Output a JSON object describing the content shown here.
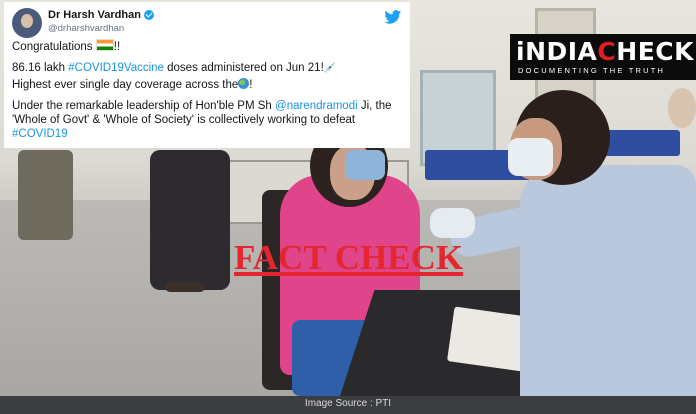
{
  "tweet": {
    "author_name": "Dr Harsh Vardhan",
    "author_handle": "@drharshvardhan",
    "line1": "Congratulations",
    "line1_suffix": "!!",
    "line2_a": "86.16 lakh ",
    "line2_tag": "#COVID19Vaccine",
    "line2_b": " doses administered on Jun 21!",
    "line3_a": "Highest ever single day coverage across the",
    "line3_b": "!",
    "line4_a": "Under the leadership of Hon'ble PM Sh ",
    "line4_a_full": "Under the remarkable leadership of Hon'ble PM Sh",
    "line4_mention": "@narendramodi",
    "line4_b": " Ji, the 'Whole of Govt' & 'Whole of Society' is collectively working to defeat ",
    "line4_tag": "#COVID19",
    "icons": [
      "verified-badge-icon",
      "twitter-bird-icon",
      "india-flag-icon",
      "syringe-icon",
      "globe-icon"
    ]
  },
  "logo": {
    "main_prefix": "iNDIA",
    "main_suffix": "HECK",
    "tagline": "DOCUMENTING THE TRUTH"
  },
  "stamp": {
    "text": "FACT CHECK",
    "color": "#e3262f"
  },
  "caption": "Image Source : PTI",
  "colors": {
    "brand_red": "#e31b23",
    "twitter_blue": "#1da1f2",
    "hashtag_blue": "#1b95e0"
  }
}
